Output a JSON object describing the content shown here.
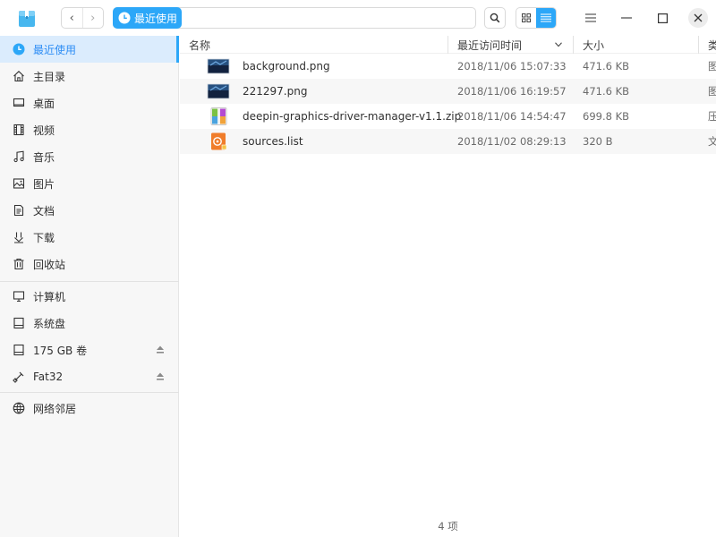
{
  "toolbar": {
    "nav_back": "‹",
    "nav_forward": "›",
    "breadcrumb_label": "最近使用"
  },
  "sidebar": {
    "items": [
      {
        "label": "最近使用",
        "icon": "clock-icon",
        "active": true
      },
      {
        "label": "主目录",
        "icon": "home-icon"
      },
      {
        "label": "桌面",
        "icon": "desktop-icon"
      },
      {
        "label": "视频",
        "icon": "video-icon"
      },
      {
        "label": "音乐",
        "icon": "music-icon"
      },
      {
        "label": "图片",
        "icon": "picture-icon"
      },
      {
        "label": "文档",
        "icon": "document-icon"
      },
      {
        "label": "下载",
        "icon": "download-icon"
      },
      {
        "label": "回收站",
        "icon": "trash-icon"
      }
    ],
    "devices": [
      {
        "label": "计算机",
        "icon": "computer-icon"
      },
      {
        "label": "系统盘",
        "icon": "disk-icon"
      },
      {
        "label": "175 GB 卷",
        "icon": "disk-icon",
        "ejectable": true
      },
      {
        "label": "Fat32",
        "icon": "usb-icon",
        "ejectable": true
      }
    ],
    "network": {
      "label": "网络邻居",
      "icon": "network-icon"
    }
  },
  "table": {
    "columns": {
      "name": "名称",
      "time": "最近访问时间",
      "size": "大小",
      "type": "类"
    },
    "rows": [
      {
        "name": "background.png",
        "time": "2018/11/06 15:07:33",
        "size": "471.6 KB",
        "type": "图",
        "icon": "image-file-icon"
      },
      {
        "name": "221297.png",
        "time": "2018/11/06 16:19:57",
        "size": "471.6 KB",
        "type": "图",
        "icon": "image-file-icon"
      },
      {
        "name": "deepin-graphics-driver-manager-v1.1.zip",
        "time": "2018/11/06 14:54:47",
        "size": "699.8 KB",
        "type": "压",
        "icon": "zip-file-icon"
      },
      {
        "name": "sources.list",
        "time": "2018/11/02 08:29:13",
        "size": "320 B",
        "type": "文",
        "icon": "text-file-icon"
      }
    ]
  },
  "status": {
    "count": "4 项"
  },
  "colors": {
    "accent": "#2ca7f8",
    "selected_bg": "#dbecfd",
    "sidebar_bg": "#f7f7f7"
  }
}
